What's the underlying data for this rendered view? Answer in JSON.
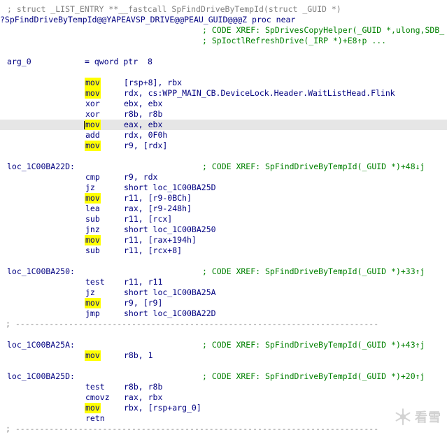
{
  "listing": {
    "lines": [
      {
        "type": "comment",
        "text": "; struct _LIST_ENTRY **__fastcall SpFindDriveByTempId(struct _GUID *)"
      },
      {
        "type": "proc",
        "text": "?SpFindDriveByTempId@@YAPEAVSP_DRIVE@@PEAU_GUID@@@Z proc near"
      },
      {
        "type": "xref",
        "col": "far",
        "text": "; CODE XREF: SpDrivesCopyHelper(_GUID *,ulong,SDB_"
      },
      {
        "type": "xref",
        "col": "far",
        "text": "; SpIoctlRefreshDrive(_IRP *)+E8↑p ..."
      },
      {
        "type": "blank"
      },
      {
        "type": "arg",
        "label": "arg_0",
        "assign": "= qword ptr  8"
      },
      {
        "type": "blank"
      },
      {
        "type": "ins",
        "mnem": "mov",
        "hl": true,
        "ops": "[rsp+8], rbx"
      },
      {
        "type": "ins",
        "mnem": "mov",
        "hl": true,
        "ops": "rdx, cs:WPP_MAIN_CB.DeviceLock.Header.WaitListHead.Flink"
      },
      {
        "type": "ins",
        "mnem": "xor",
        "hl": false,
        "ops": "ebx, ebx"
      },
      {
        "type": "ins",
        "mnem": "xor",
        "hl": false,
        "ops": "r8b, r8b"
      },
      {
        "type": "ins",
        "mnem": "mov",
        "hl": true,
        "cursor": true,
        "ops": "eax, ebx"
      },
      {
        "type": "ins",
        "mnem": "add",
        "hl": false,
        "ops": "rdx, 0F0h"
      },
      {
        "type": "ins",
        "mnem": "mov",
        "hl": true,
        "ops": "r9, [rdx]"
      },
      {
        "type": "blank"
      },
      {
        "type": "loc",
        "label": "loc_1C00BA22D:",
        "text": "; CODE XREF: SpFindDriveByTempId(_GUID *)+48↓j"
      },
      {
        "type": "ins",
        "mnem": "cmp",
        "hl": false,
        "ops": "r9, rdx"
      },
      {
        "type": "ins",
        "mnem": "jz",
        "hl": false,
        "ops": "short loc_1C00BA25D"
      },
      {
        "type": "ins",
        "mnem": "mov",
        "hl": true,
        "ops": "r11, [r9-0BCh]"
      },
      {
        "type": "ins",
        "mnem": "lea",
        "hl": false,
        "ops": "rax, [r9-248h]"
      },
      {
        "type": "ins",
        "mnem": "sub",
        "hl": false,
        "ops": "r11, [rcx]"
      },
      {
        "type": "ins",
        "mnem": "jnz",
        "hl": false,
        "ops": "short loc_1C00BA250"
      },
      {
        "type": "ins",
        "mnem": "mov",
        "hl": true,
        "ops": "r11, [rax+194h]"
      },
      {
        "type": "ins",
        "mnem": "sub",
        "hl": false,
        "ops": "r11, [rcx+8]"
      },
      {
        "type": "blank"
      },
      {
        "type": "loc",
        "label": "loc_1C00BA250:",
        "text": "; CODE XREF: SpFindDriveByTempId(_GUID *)+33↑j"
      },
      {
        "type": "ins",
        "mnem": "test",
        "hl": false,
        "ops": "r11, r11"
      },
      {
        "type": "ins",
        "mnem": "jz",
        "hl": false,
        "ops": "short loc_1C00BA25A"
      },
      {
        "type": "ins",
        "mnem": "mov",
        "hl": true,
        "ops": "r9, [r9]"
      },
      {
        "type": "ins",
        "mnem": "jmp",
        "hl": false,
        "ops": "short loc_1C00BA22D"
      },
      {
        "type": "sep",
        "text": "; ---------------------------------------------------------------------------"
      },
      {
        "type": "blank"
      },
      {
        "type": "loc",
        "label": "loc_1C00BA25A:",
        "text": "; CODE XREF: SpFindDriveByTempId(_GUID *)+43↑j"
      },
      {
        "type": "ins",
        "mnem": "mov",
        "hl": true,
        "ops": "r8b, 1"
      },
      {
        "type": "blank"
      },
      {
        "type": "loc",
        "label": "loc_1C00BA25D:",
        "text": "; CODE XREF: SpFindDriveByTempId(_GUID *)+20↑j"
      },
      {
        "type": "ins",
        "mnem": "test",
        "hl": false,
        "ops": "r8b, r8b"
      },
      {
        "type": "ins",
        "mnem": "cmovz",
        "hl": false,
        "ops": "rax, rbx"
      },
      {
        "type": "ins",
        "mnem": "mov",
        "hl": true,
        "ops": "rbx, [rsp+arg_0]"
      },
      {
        "type": "ins",
        "mnem": "retn",
        "hl": false,
        "ops": ""
      },
      {
        "type": "sep",
        "text": "; ---------------------------------------------------------------------------"
      }
    ]
  },
  "watermark": {
    "text": "看雪"
  },
  "colors": {
    "background": "#ffffff",
    "code": "#000080",
    "comment": "#008000",
    "label": "#000080",
    "highlight": "#ffff00",
    "cursor_line": "#e6e6e6",
    "gutter_arrow": "#0000ff"
  }
}
